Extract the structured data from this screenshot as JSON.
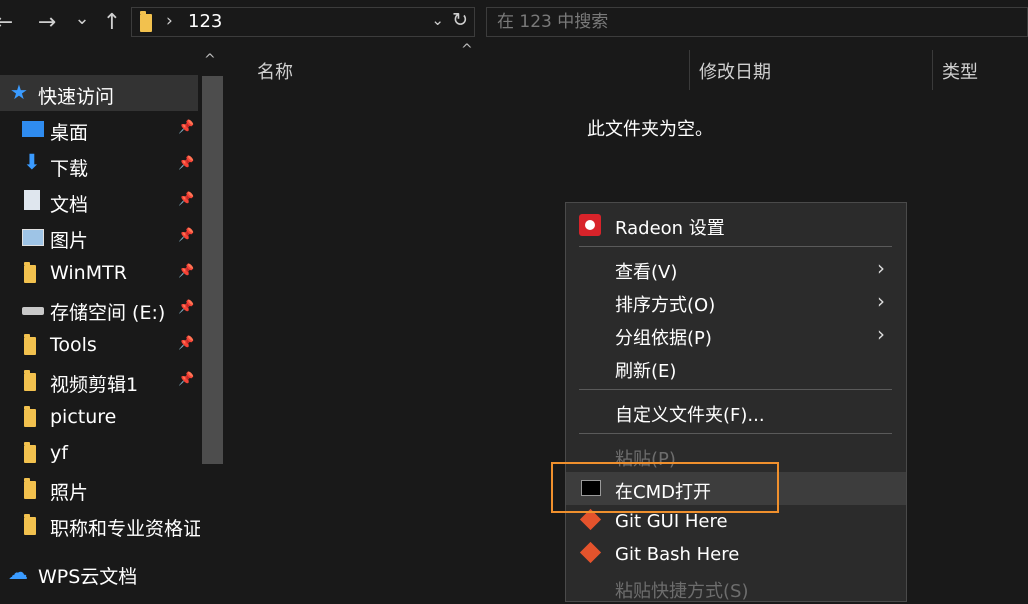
{
  "toolbar": {
    "back_glyph": "←",
    "forward_glyph": "→",
    "recent_glyph": "⌄",
    "up_glyph": "↑",
    "address": {
      "path": "123",
      "separator": "›",
      "dropdown_glyph": "⌄",
      "refresh_glyph": "↻"
    },
    "search": {
      "placeholder": "在 123 中搜索"
    }
  },
  "sidebar": {
    "quick_access": "快速访问",
    "items": [
      {
        "label": "桌面",
        "icon": "desktop-icon",
        "pinned": true
      },
      {
        "label": "下载",
        "icon": "download-icon",
        "pinned": true
      },
      {
        "label": "文档",
        "icon": "document-icon",
        "pinned": true
      },
      {
        "label": "图片",
        "icon": "picture-icon",
        "pinned": true
      },
      {
        "label": "WinMTR",
        "icon": "folder-icon",
        "pinned": true
      },
      {
        "label": "存储空间 (E:)",
        "icon": "drive-icon",
        "pinned": true
      },
      {
        "label": "Tools",
        "icon": "folder-icon",
        "pinned": true
      },
      {
        "label": "视频剪辑1",
        "icon": "folder-icon",
        "pinned": true
      },
      {
        "label": "picture",
        "icon": "folder-icon",
        "pinned": false
      },
      {
        "label": "yf",
        "icon": "folder-icon",
        "pinned": false
      },
      {
        "label": "照片",
        "icon": "folder-icon",
        "pinned": false
      },
      {
        "label": "职称和专业资格证书",
        "icon": "folder-icon",
        "pinned": false
      }
    ],
    "wps": "WPS云文档",
    "pin_glyph": "📌"
  },
  "content": {
    "columns": {
      "name": "名称",
      "modified": "修改日期",
      "type": "类型"
    },
    "sort_glyph": "^",
    "empty_text": "此文件夹为空。"
  },
  "context_menu": {
    "radeon": "Radeon 设置",
    "view": "查看(V)",
    "sort_by": "排序方式(O)",
    "group_by": "分组依据(P)",
    "refresh": "刷新(E)",
    "customize": "自定义文件夹(F)...",
    "paste": "粘贴(P)",
    "open_cmd": "在CMD打开",
    "git_gui": "Git GUI Here",
    "git_bash": "Git Bash Here",
    "paste_shortcut": "粘贴快捷方式(S)",
    "submenu_glyph": "›"
  },
  "colors": {
    "highlight_border": "#f0902d",
    "folder": "#f2c14e",
    "accent": "#1e90ff"
  }
}
